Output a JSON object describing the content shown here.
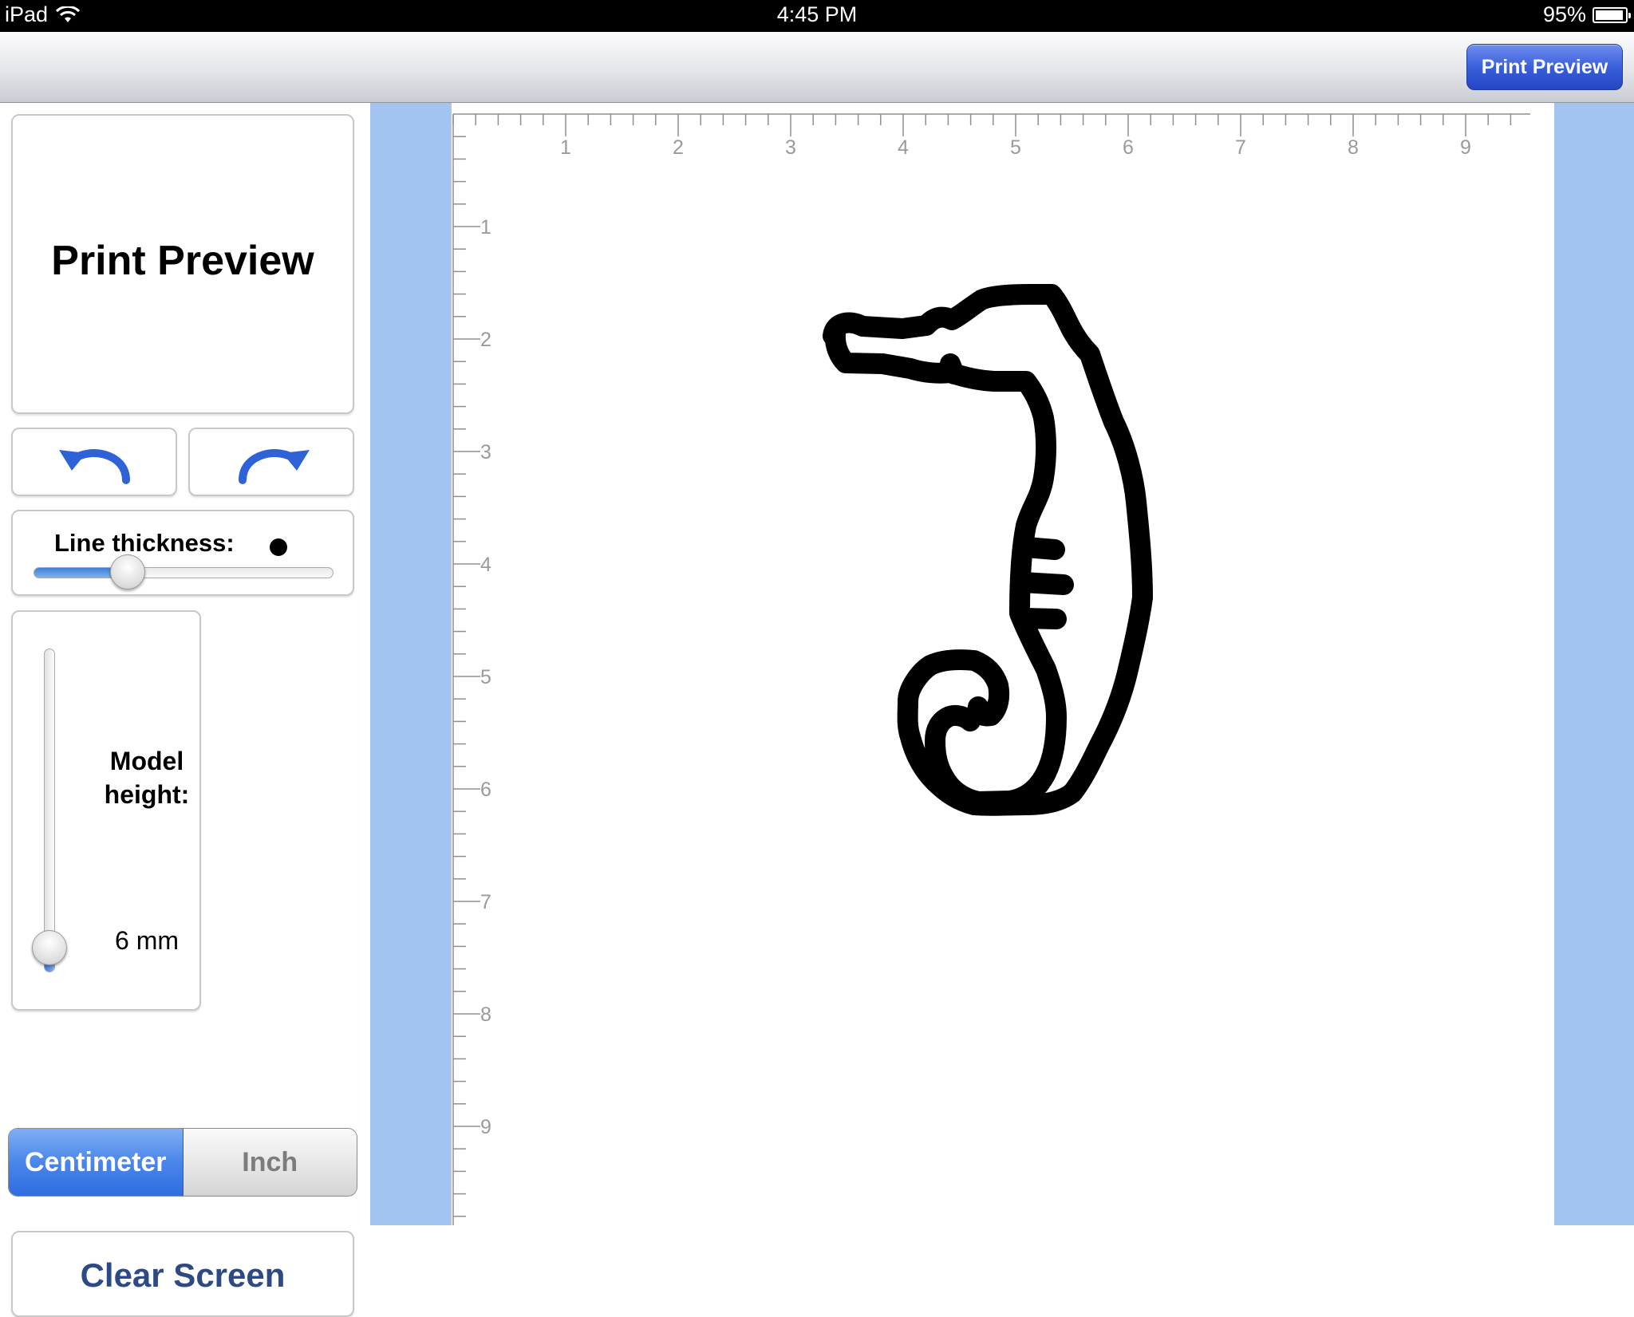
{
  "status_bar": {
    "device": "iPad",
    "time": "4:45 PM",
    "battery_pct": "95%",
    "battery_level": 0.95
  },
  "nav_bar": {
    "print_preview_button": "Print Preview"
  },
  "left_panel": {
    "preview_title": "Print Preview",
    "line_thickness": {
      "label": "Line thickness:",
      "slider_level": 0.31
    },
    "model_height": {
      "label_line1": "Model",
      "label_line2": "height:",
      "value": "6 mm",
      "slider_level": 0.08
    },
    "units": {
      "options": [
        "Centimeter",
        "Inch"
      ],
      "selected": "Centimeter"
    },
    "clear_button": "Clear Screen"
  },
  "ruler": {
    "horizontal_labels": [
      "1",
      "2",
      "3",
      "4",
      "5",
      "6",
      "7",
      "8",
      "9"
    ],
    "vertical_labels": [
      "1",
      "2",
      "3",
      "4",
      "5",
      "6",
      "7",
      "8",
      "9"
    ]
  },
  "colors": {
    "canvas_background": "#a3c3f0",
    "accent_blue": "#3a6fe0",
    "clear_text": "#2d4a83"
  }
}
